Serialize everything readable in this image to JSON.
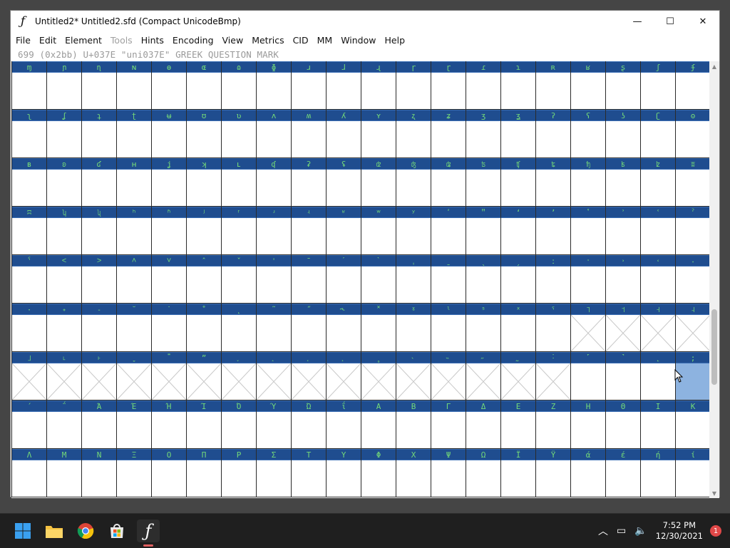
{
  "window": {
    "title": "Untitled2*  Untitled2.sfd (Compact UnicodeBmp)",
    "minimize": "—",
    "maximize": "☐",
    "close": "✕"
  },
  "menu": [
    {
      "label": "File",
      "enabled": true
    },
    {
      "label": "Edit",
      "enabled": true
    },
    {
      "label": "Element",
      "enabled": true
    },
    {
      "label": "Tools",
      "enabled": false
    },
    {
      "label": "Hints",
      "enabled": true
    },
    {
      "label": "Encoding",
      "enabled": true
    },
    {
      "label": "View",
      "enabled": true
    },
    {
      "label": "Metrics",
      "enabled": true
    },
    {
      "label": "CID",
      "enabled": true
    },
    {
      "label": "MM",
      "enabled": true
    },
    {
      "label": "Window",
      "enabled": true
    },
    {
      "label": "Help",
      "enabled": true
    }
  ],
  "info_line": "699 (0x2bb) U+037E \"uni037E\" GREEK QUESTION MARK",
  "glyph_rows": [
    {
      "labels": [
        "ɱ",
        "ɲ",
        "ɳ",
        "ɴ",
        "ɵ",
        "ɶ",
        "ɷ",
        "ɸ",
        "ɹ",
        "ɺ",
        "ɻ",
        "ɼ",
        "ɽ",
        "ɾ",
        "ɿ",
        "ʀ",
        "ʁ",
        "ʂ",
        "ʃ",
        "ʄ"
      ],
      "empty": []
    },
    {
      "labels": [
        "ʅ",
        "ʆ",
        "ʇ",
        "ʈ",
        "ʉ",
        "ʊ",
        "ʋ",
        "ʌ",
        "ʍ",
        "ʎ",
        "ʏ",
        "ʐ",
        "ʑ",
        "ʒ",
        "ʓ",
        "ʔ",
        "ʕ",
        "ʖ",
        "ʗ",
        "ʘ"
      ],
      "empty": []
    },
    {
      "labels": [
        "ʙ",
        "ʚ",
        "ʛ",
        "ʜ",
        "ʝ",
        "ʞ",
        "ʟ",
        "ʠ",
        "ʡ",
        "ʢ",
        "ʣ",
        "ʤ",
        "ʥ",
        "ʦ",
        "ʧ",
        "ʨ",
        "ʩ",
        "ʪ",
        "ʫ",
        "ʬ"
      ],
      "empty": []
    },
    {
      "labels": [
        "ʭ",
        "ʮ",
        "ʯ",
        "ʰ",
        "ʱ",
        "ʲ",
        "ʳ",
        "ʴ",
        "ʵ",
        "ʶ",
        "ʷ",
        "ʸ",
        "ʹ",
        "ʺ",
        "ʻ",
        "ʼ",
        "ʽ",
        "ʾ",
        "ʿ",
        "ˀ"
      ],
      "empty": []
    },
    {
      "labels": [
        "ˁ",
        "˂",
        "˃",
        "˄",
        "˅",
        "ˆ",
        "ˇ",
        "ˈ",
        "ˉ",
        "ˊ",
        "ˋ",
        "ˌ",
        "ˍ",
        "ˎ",
        "ˏ",
        "ː",
        "ˑ",
        "˒",
        "˓",
        "˔"
      ],
      "empty": []
    },
    {
      "labels": [
        "˕",
        "˖",
        "˗",
        "˘",
        "˙",
        "˚",
        "˛",
        "˜",
        "˝",
        "˞",
        "˟",
        "ˠ",
        "ˡ",
        "ˢ",
        "ˣ",
        "ˤ",
        "˥",
        "˦",
        "˧",
        "˨"
      ],
      "empty": [
        16,
        17,
        18,
        19
      ]
    },
    {
      "labels": [
        "˩",
        "˪",
        "˫",
        "ˬ",
        "˭",
        "ˮ",
        "˯",
        "˰",
        "˱",
        "˲",
        "˳",
        "˴",
        "˵",
        "˶",
        "˷",
        "˸",
        "˹",
        "˺",
        "˻",
        ";"
      ],
      "empty": [
        0,
        1,
        2,
        3,
        4,
        5,
        6,
        7,
        8,
        9,
        10,
        11,
        12,
        13,
        14,
        15
      ]
    },
    {
      "labels": [
        "΄",
        "΅",
        "Ά",
        "Έ",
        "Ή",
        "Ί",
        "Ό",
        "Ύ",
        "Ώ",
        "ΐ",
        "Α",
        "Β",
        "Γ",
        "Δ",
        "Ε",
        "Ζ",
        "Η",
        "Θ",
        "Ι",
        "Κ"
      ],
      "empty": []
    },
    {
      "labels": [
        "Λ",
        "Μ",
        "Ν",
        "Ξ",
        "Ο",
        "Π",
        "Ρ",
        "Σ",
        "Τ",
        "Υ",
        "Φ",
        "Χ",
        "Ψ",
        "Ω",
        "Ϊ",
        "Ϋ",
        "ά",
        "έ",
        "ή",
        "ί"
      ],
      "empty": []
    }
  ],
  "selected_cell": {
    "row": 6,
    "col": 19
  },
  "colors": {
    "label_bg": "#1f4d8f",
    "label_text": "#74d978",
    "selected": "#8db3e0"
  },
  "taskbar": {
    "apps": [
      {
        "icon": "windows-start-icon"
      },
      {
        "icon": "file-explorer-icon"
      },
      {
        "icon": "chrome-icon"
      },
      {
        "icon": "microsoft-store-icon"
      },
      {
        "icon": "fontforge-icon"
      }
    ],
    "time": "7:52 PM",
    "date": "12/30/2021",
    "notification_count": "1"
  }
}
